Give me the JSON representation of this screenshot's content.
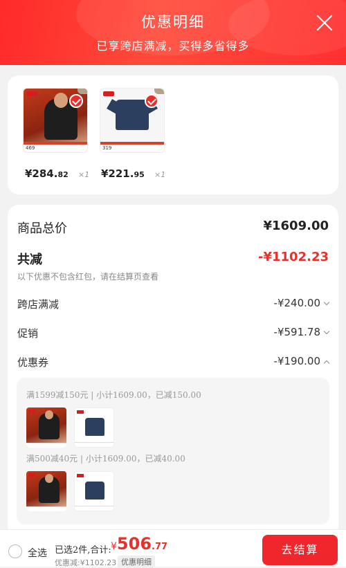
{
  "header": {
    "title": "优惠明细",
    "subtitle": "已享跨店满减，买得多省得多"
  },
  "products": [
    {
      "price_main": "¥284.",
      "price_dec": "82",
      "qty": "×1",
      "tag_text": "469",
      "checked": true
    },
    {
      "price_main": "¥221.",
      "price_dec": "95",
      "qty": "×1",
      "tag_text": "319",
      "checked": true
    }
  ],
  "summary": {
    "total_label": "商品总价",
    "total_value": "¥1609.00",
    "reduce_label": "共减",
    "reduce_value": "-¥1102.23",
    "note": "以下优惠不包含红包，请在结算页查看",
    "items": [
      {
        "label": "跨店满减",
        "value": "-¥240.00",
        "expanded": false
      },
      {
        "label": "促销",
        "value": "-¥591.78",
        "expanded": false
      },
      {
        "label": "优惠券",
        "value": "-¥190.00",
        "expanded": true
      }
    ]
  },
  "coupons": [
    {
      "text": "满1599减150元 | 小计1609.00，已减150.00"
    },
    {
      "text": "满500减40元 | 小计1609.00，已减40.00"
    }
  ],
  "footer": {
    "select_all": "全选",
    "selected_text": "已选2件,合计:",
    "total_yen": "¥",
    "total_int": "506",
    "total_dec": ".77",
    "discount_text": "优惠减:¥1102.23",
    "detail_button": "优惠明细",
    "checkout_button": "去结算"
  },
  "colors": {
    "accent": "#e8302a",
    "button": "#f0262d",
    "header": "#ff3a2e"
  }
}
